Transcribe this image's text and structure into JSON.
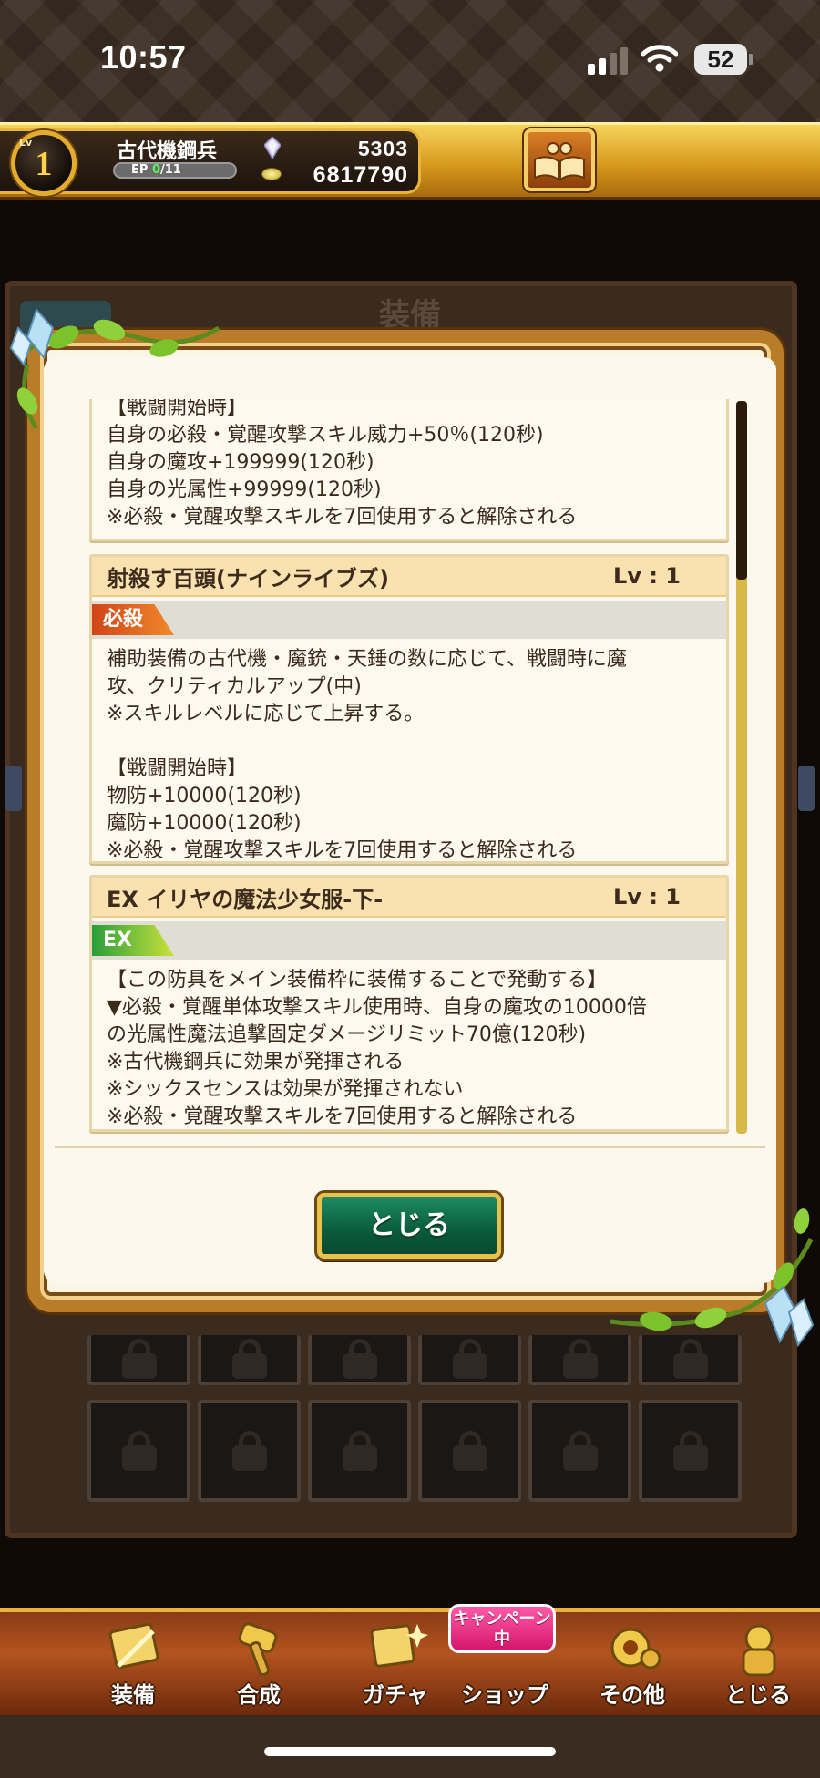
{
  "status_bar": {
    "time": "10:57",
    "battery": "52"
  },
  "header": {
    "level_tag": "Lv",
    "level": "1",
    "player_name": "古代機鋼兵",
    "ep_label": "EP",
    "ep_current": "0",
    "ep_max": "/11",
    "gems": "5303",
    "coins": "6817790"
  },
  "backdrop": {
    "title": "装備"
  },
  "popup": {
    "cards": [
      {
        "lines": [
          "【戦闘開始時】",
          "自身の必殺・覚醒攻撃スキル威力+50％(120秒)",
          "自身の魔攻+199999(120秒)",
          "自身の光属性+99999(120秒)",
          "※必殺・覚醒攻撃スキルを7回使用すると解除される"
        ]
      },
      {
        "name": "射殺す百頭(ナインライブズ)",
        "level": "Lv : 1",
        "tag": "必殺",
        "lines": [
          "補助装備の古代機・魔銃・天錘の数に応じて、戦闘時に魔",
          "攻、クリティカルアップ(中)",
          "※スキルレベルに応じて上昇する。",
          "",
          "【戦闘開始時】",
          "物防+10000(120秒)",
          "魔防+10000(120秒)",
          "※必殺・覚醒攻撃スキルを7回使用すると解除される"
        ]
      },
      {
        "name": "EX イリヤの魔法少女服-下-",
        "level": "Lv : 1",
        "tag": "EX",
        "lines": [
          "【この防具をメイン装備枠に装備することで発動する】",
          "▼必殺・覚醒単体攻撃スキル使用時、自身の魔攻の10000倍",
          "の光属性魔法追撃固定ダメージリミット70億(120秒)",
          "※古代機鋼兵に効果が発揮される",
          "※シックスセンスは効果が発揮されない",
          "※必殺・覚醒攻撃スキルを7回使用すると解除される"
        ]
      }
    ],
    "close_label": "とじる"
  },
  "bottom_nav": {
    "items": [
      {
        "label": "装備",
        "icon": "equipment-icon"
      },
      {
        "label": "合成",
        "icon": "hammer-icon"
      },
      {
        "label": "ガチャ",
        "icon": "gacha-icon"
      },
      {
        "label": "ショップ",
        "icon": "shop-icon"
      },
      {
        "label": "その他",
        "icon": "gear-icon"
      },
      {
        "label": "とじる",
        "icon": "close-icon"
      }
    ],
    "campaign_badge": "キャンペーン中"
  },
  "colors": {
    "accent_gold": "#e4ac2f",
    "close_button_green": "#0a5a3c",
    "hissatsu_tag": "#d0451a",
    "ex_tag": "#2a9e3a"
  }
}
